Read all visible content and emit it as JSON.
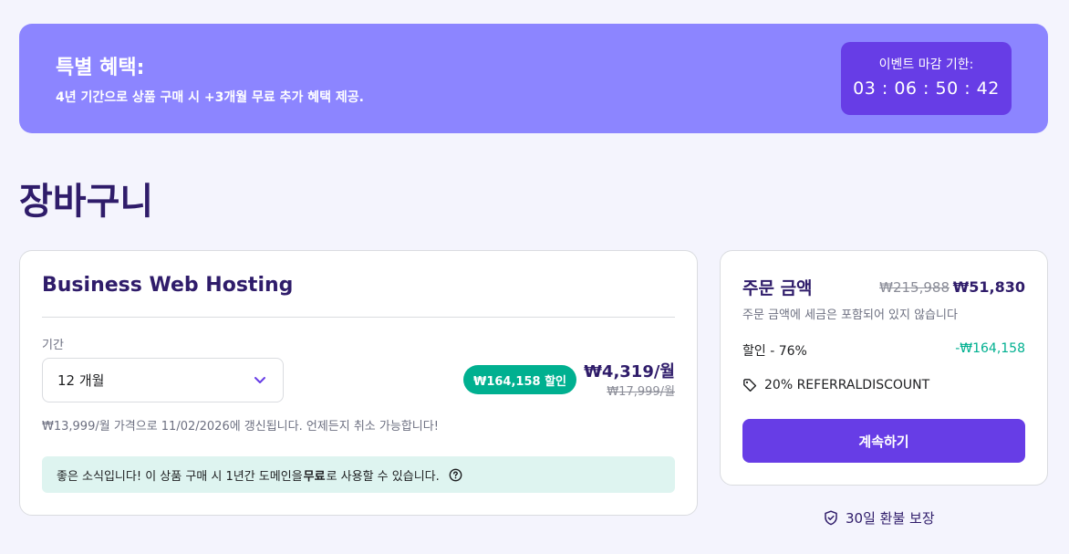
{
  "promo": {
    "title": "특별 혜택:",
    "subtitle": "4년 기간으로 상품 구매 시 +3개월 무료 추가 혜택 제공.",
    "timer_label": "이벤트 마감 기한:",
    "timer_value": "03 : 06 : 50 : 42"
  },
  "page": {
    "title": "장바구니"
  },
  "cart": {
    "product_name": "Business Web Hosting",
    "period_label": "기간",
    "period_value": "12 개월",
    "discount_badge": "₩164,158 할인",
    "price_now": "₩4,319/월",
    "price_old": "₩17,999/월",
    "renew_note": "₩13,999/월 가격으로 11/02/2026에 갱신됩니다. 언제든지 취소 가능합니다!",
    "domain_banner": {
      "before": "좋은 소식입니다! 이 상품 구매 시 1년간 도메인을 ",
      "bold": "무료",
      "after": "로 사용할 수 있습니다."
    }
  },
  "summary": {
    "title": "주문 금액",
    "old_total": "₩215,988",
    "total": "₩51,830",
    "tax_note": "주문 금액에 세금은 포함되어 있지 않습니다",
    "discount_label": "할인 - 76%",
    "discount_value": "-₩164,158",
    "coupon": "20% REFERRALDISCOUNT",
    "continue_label": "계속하기"
  },
  "guarantee": "30일 환불 보장",
  "colors": {
    "accent": "#673de6",
    "banner": "#8c85ff",
    "success": "#00b090",
    "heading": "#2f1c6a"
  },
  "icons": [
    "chevron-down-icon",
    "help-icon",
    "tag-icon",
    "shield-check-icon"
  ]
}
